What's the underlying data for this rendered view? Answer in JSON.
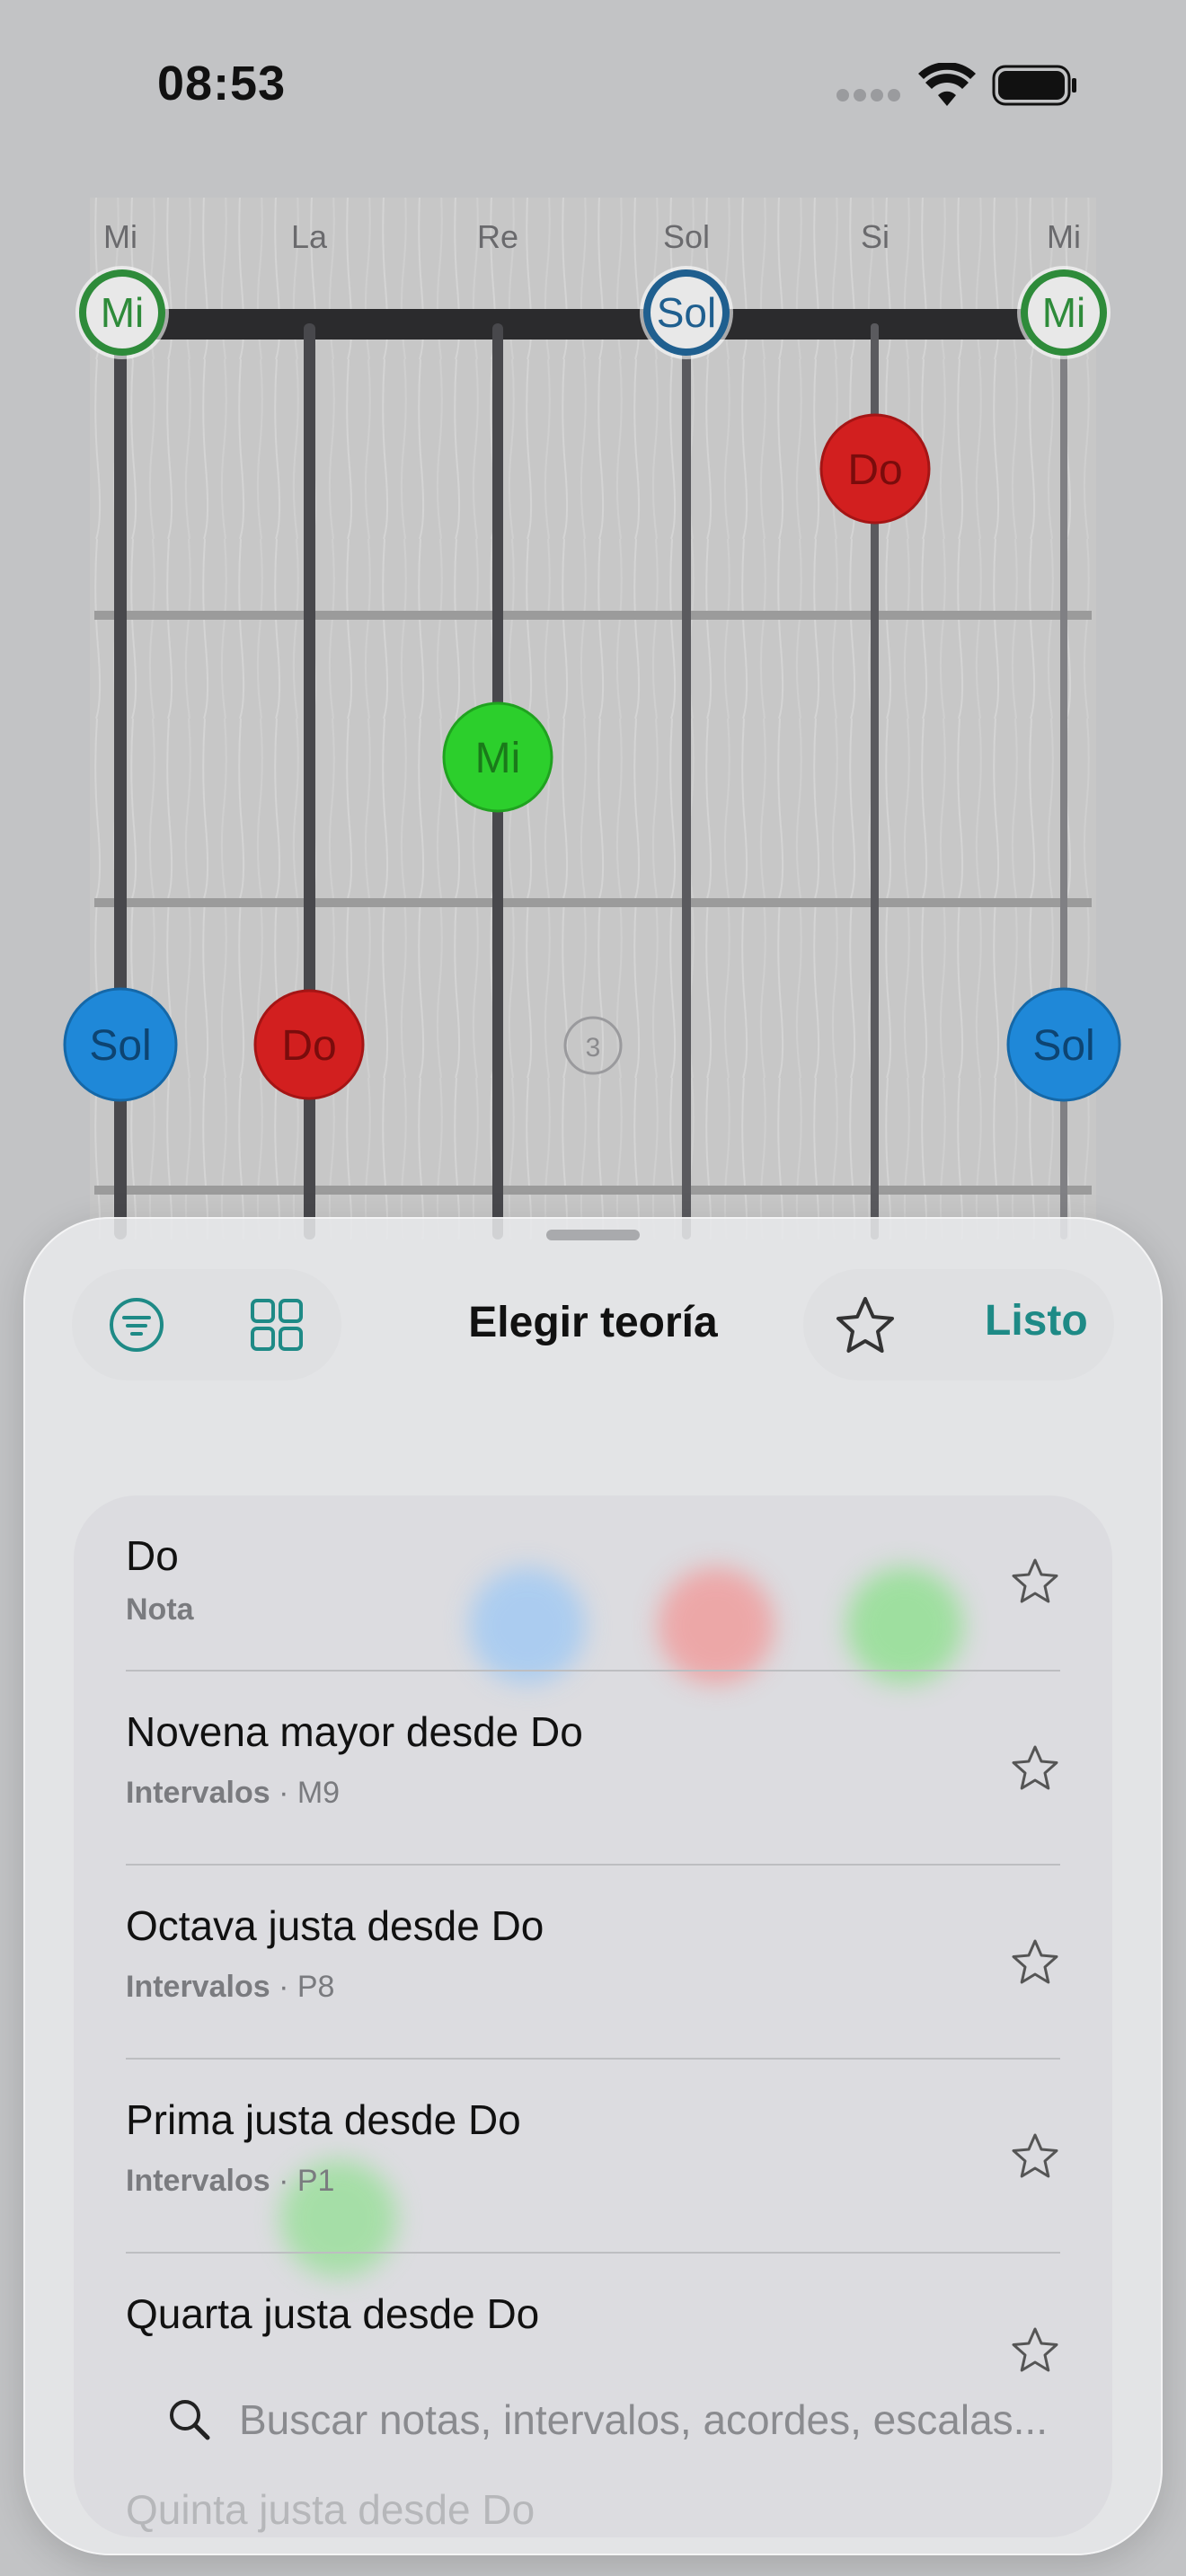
{
  "status_bar": {
    "time": "08:53"
  },
  "fretboard": {
    "string_labels": [
      "Mi",
      "La",
      "Re",
      "Sol",
      "Si",
      "Mi"
    ],
    "open_notes": [
      {
        "string": 1,
        "note": "Mi",
        "color": "#2e8b3a"
      },
      {
        "string": 4,
        "note": "Sol",
        "color": "#1f5f8f"
      },
      {
        "string": 6,
        "note": "Mi",
        "color": "#2e8b3a"
      }
    ],
    "fret_markers": [
      {
        "string": 5,
        "fret": 1,
        "note": "Do",
        "color": "#d21f1f"
      },
      {
        "string": 3,
        "fret": 2,
        "note": "Mi",
        "color": "#2ccf2c"
      },
      {
        "string": 1,
        "fret": 3,
        "note": "Sol",
        "color": "#1f88d8"
      },
      {
        "string": 2,
        "fret": 3,
        "note": "Do",
        "color": "#d21f1f"
      },
      {
        "string": 6,
        "fret": 3,
        "note": "Sol",
        "color": "#1f88d8"
      }
    ],
    "fret_number": "3"
  },
  "sheet": {
    "title": "Elegir teoría",
    "done_label": "Listo",
    "filter_icon": "filter-icon",
    "grid_icon": "grid-icon",
    "favorite_icon": "star-icon",
    "items": [
      {
        "title": "Do",
        "category": "Nota",
        "detail": ""
      },
      {
        "title": "Novena mayor desde Do",
        "category": "Intervalos",
        "detail": "M9"
      },
      {
        "title": "Octava justa desde Do",
        "category": "Intervalos",
        "detail": "P8"
      },
      {
        "title": "Prima justa desde Do",
        "category": "Intervalos",
        "detail": "P1"
      },
      {
        "title": "Quarta justa desde Do",
        "category": "",
        "detail": ""
      },
      {
        "title": "Quinta justa desde Do",
        "category": "",
        "detail": ""
      }
    ],
    "search_placeholder": "Buscar notas, intervalos, acordes, escalas..."
  },
  "colors": {
    "accent": "#1e8a86",
    "red": "#d21f1f",
    "blue": "#1f88d8",
    "green": "#2ccf2c"
  }
}
